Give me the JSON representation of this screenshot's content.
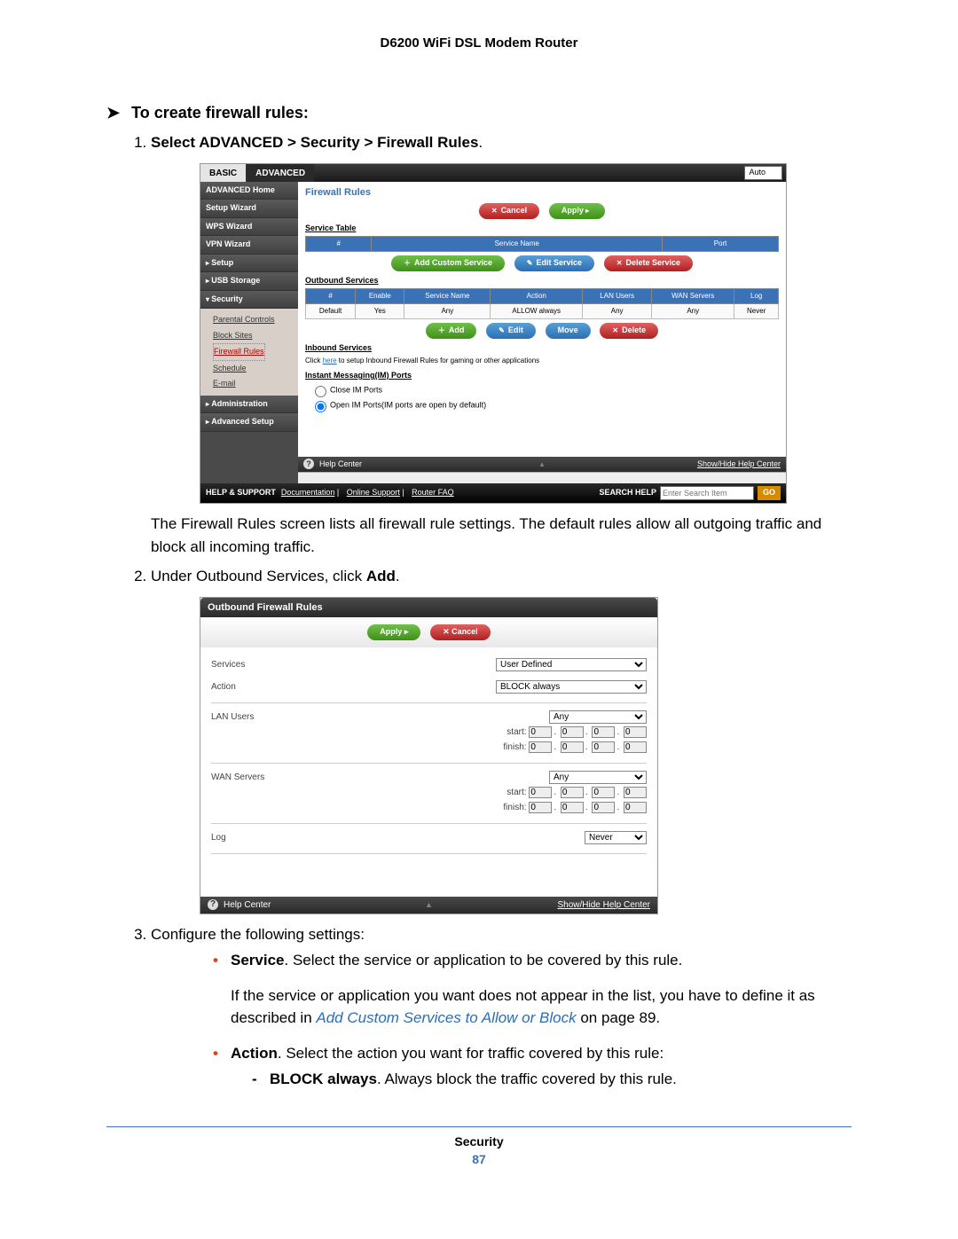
{
  "doc_header": "D6200 WiFi DSL Modem Router",
  "task_title": "To create firewall rules:",
  "step1_prefix": "Select ",
  "step1_nav": "ADVANCED > Security > Firewall Rules",
  "step1_suffix": ".",
  "ui1": {
    "tab_basic": "BASIC",
    "tab_advanced": "ADVANCED",
    "auto": "Auto",
    "sidebar": {
      "home": "ADVANCED Home",
      "setup_wizard": "Setup Wizard",
      "wps_wizard": "WPS Wizard",
      "vpn_wizard": "VPN Wizard",
      "setup": "Setup",
      "usb_storage": "USB Storage",
      "security": "Security",
      "parental": "Parental Controls",
      "block_sites": "Block Sites",
      "firewall_rules": "Firewall Rules",
      "schedule": "Schedule",
      "email": "E-mail",
      "administration": "Administration",
      "advanced_setup": "Advanced Setup"
    },
    "main_title": "Firewall Rules",
    "btn_cancel": "Cancel",
    "btn_apply": "Apply",
    "service_table": "Service Table",
    "col_hash": "#",
    "col_service_name": "Service Name",
    "col_port": "Port",
    "btn_add_custom": "Add Custom Service",
    "btn_edit_service": "Edit Service",
    "btn_delete_service": "Delete Service",
    "outbound": "Outbound Services",
    "col_enable": "Enable",
    "col_action": "Action",
    "col_lan": "LAN Users",
    "col_wan": "WAN Servers",
    "col_log": "Log",
    "row_default": "Default",
    "row_yes": "Yes",
    "row_any": "Any",
    "row_allow": "ALLOW always",
    "row_never": "Never",
    "btn_add": "Add",
    "btn_edit": "Edit",
    "btn_move": "Move",
    "btn_delete": "Delete",
    "inbound": "Inbound Services",
    "inbound_note_pre": "Click ",
    "inbound_note_link": "here",
    "inbound_note_post": " to setup Inbound Firewall Rules for gaming or other applications",
    "im_heading": "Instant Messaging(IM) Ports",
    "im_close": "Close IM Ports",
    "im_open": "Open IM Ports(IM ports are open by default)",
    "help_center": "Help Center",
    "show_hide": "Show/Hide Help Center",
    "support_label": "HELP & SUPPORT",
    "support_links": [
      "Documentation",
      "Online Support",
      "Router FAQ"
    ],
    "search_label": "SEARCH HELP",
    "search_placeholder": "Enter Search Item",
    "go": "GO"
  },
  "step1_body": "The Firewall Rules screen lists all firewall rule settings. The default rules allow all outgoing traffic and block all incoming traffic.",
  "step2_text_pre": "Under Outbound Services, click ",
  "step2_bold": "Add",
  "step2_text_post": ".",
  "ui2": {
    "title": "Outbound Firewall Rules",
    "apply": "Apply",
    "cancel": "Cancel",
    "lbl_services": "Services",
    "sel_services": "User Defined",
    "lbl_action": "Action",
    "sel_action": "BLOCK always",
    "lbl_lan": "LAN Users",
    "lbl_wan": "WAN Servers",
    "sel_any": "Any",
    "start": "start:",
    "finish": "finish:",
    "ip_zero": "0",
    "lbl_log": "Log",
    "sel_log": "Never",
    "help_center": "Help Center",
    "show_hide": "Show/Hide Help Center"
  },
  "step3_text": "Configure the following settings:",
  "bul_service_bold": "Service",
  "bul_service_text": ". Select the service or application to be covered by this rule.",
  "bul_service_para2a": "If the service or application you want does not appear in the list, you have to define it as described in ",
  "bul_service_xref": "Add Custom Services to Allow or Block",
  "bul_service_para2b": " on page 89.",
  "bul_action_bold": "Action",
  "bul_action_text": ". Select the action you want for traffic covered by this rule:",
  "dash_block_bold": "BLOCK always",
  "dash_block_text": ". Always block the traffic covered by this rule.",
  "footer_section": "Security",
  "footer_page": "87"
}
